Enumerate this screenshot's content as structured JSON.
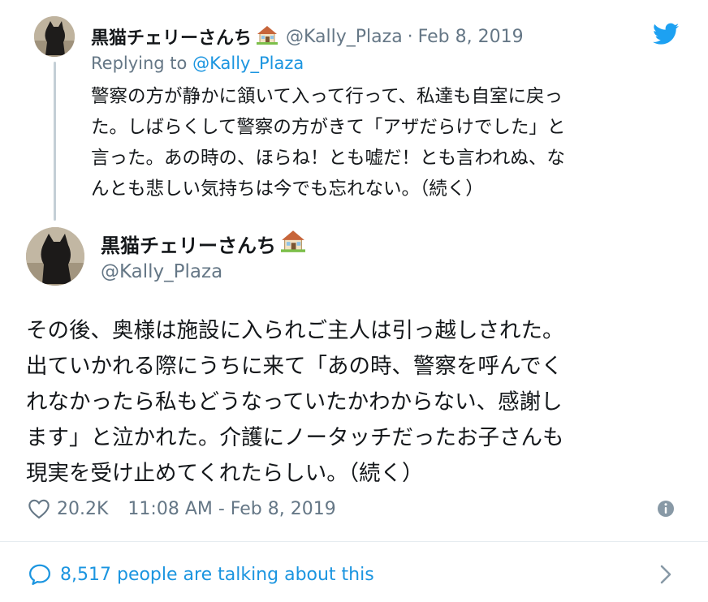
{
  "parent_tweet": {
    "display_name": "黒猫チェリーさんち",
    "handle": "@Kally_Plaza",
    "date": "Feb 8, 2019",
    "replying_prefix": "Replying to",
    "replying_handle": "@Kally_Plaza",
    "lines": [
      "警察の方が静かに頷いて入って行って、私達も自室に戻っ",
      "た。しばらくして警察の方がきて「アザだらけでした」と",
      "言った。あの時の、ほらね！とも嘘だ！とも言われぬ、な",
      "んとも悲しい気持ちは今でも忘れない。（続く）"
    ]
  },
  "main_tweet": {
    "display_name": "黒猫チェリーさんち",
    "handle": "@Kally_Plaza",
    "lines": [
      "その後、奥様は施設に入られご主人は引っ越しされた。",
      "出ていかれる際にうちに来て「あの時、警察を呼んでく",
      "れなかったら私もどうなっていたかわからない、感謝し",
      "ます」と泣かれた。介護にノータッチだったお子さんも",
      "現実を受け止めてくれたらしい。（続く）"
    ],
    "likes": "20.2K",
    "timestamp": "11:08 AM - Feb 8, 2019"
  },
  "footer": {
    "talking_text": "8,517 people are talking about this"
  },
  "colors": {
    "text": "#14171a",
    "muted": "#657786",
    "twitter_blue": "#1b95e0",
    "divider": "#e6ecf0"
  },
  "icons": {
    "house": "house-emoji",
    "bird": "twitter-bird-icon",
    "heart": "heart-outline-icon",
    "info": "info-circle-icon",
    "comment": "speech-bubble-icon",
    "chevron": "chevron-right-icon"
  }
}
